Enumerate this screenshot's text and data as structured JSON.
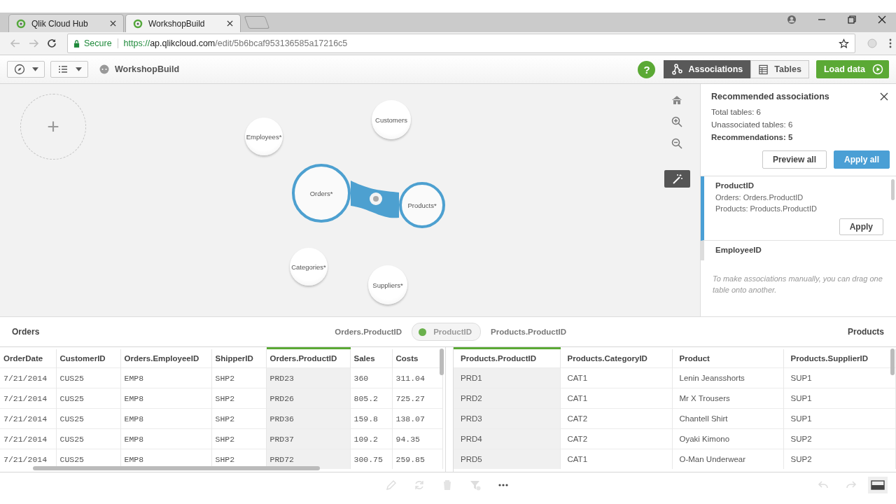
{
  "browser": {
    "tabs": [
      {
        "title": "Qlik Cloud Hub",
        "selected": false
      },
      {
        "title": "WorkshopBuild",
        "selected": true
      }
    ],
    "url": {
      "secure_label": "Secure",
      "scheme": "https://",
      "host": "ap.qlikcloud.com",
      "path": "/edit/5b6bcaf953136585a17216c5"
    }
  },
  "toolbar": {
    "app_name": "WorkshopBuild",
    "help": "?",
    "views": [
      {
        "label": "Associations",
        "selected": true
      },
      {
        "label": "Tables",
        "selected": false
      }
    ],
    "load_button": "Load data"
  },
  "canvas": {
    "add_label": "+",
    "nodes": [
      {
        "label": "Employees*",
        "selected": false
      },
      {
        "label": "Customers",
        "selected": false
      },
      {
        "label": "Orders*",
        "selected": true
      },
      {
        "label": "Products*",
        "selected": true
      },
      {
        "label": "Categories*",
        "selected": false
      },
      {
        "label": "Suppliers*",
        "selected": false
      }
    ]
  },
  "panel": {
    "title": "Recommended associations",
    "stats": [
      {
        "text": "Total tables: 6",
        "kind": "plain"
      },
      {
        "text": "Unassociated tables: 6",
        "kind": "plain"
      },
      {
        "text": "Recommendations: 5",
        "kind": "bold"
      }
    ],
    "preview_button": "Preview all",
    "apply_all_button": "Apply all",
    "recommendations": [
      {
        "title": "ProductID",
        "lines": [
          "Orders: Orders.ProductID",
          "Products: Products.ProductID"
        ],
        "apply": "Apply",
        "selected": true
      },
      {
        "title": "EmployeeID",
        "selected": false
      }
    ],
    "hint": "To make associations manually, you can drag one table onto another."
  },
  "association_bar": {
    "left_table": "Orders",
    "left_field": "Orders.ProductID",
    "key": "ProductID",
    "right_field": "Products.ProductID",
    "right_table": "Products"
  },
  "tables": [
    {
      "columns": [
        {
          "name": "OrderDate",
          "highlighted": false
        },
        {
          "name": "CustomerID",
          "highlighted": false
        },
        {
          "name": "Orders.EmployeeID",
          "highlighted": false
        },
        {
          "name": "ShipperID",
          "highlighted": false
        },
        {
          "name": "Orders.ProductID",
          "highlighted": true
        },
        {
          "name": "Sales",
          "highlighted": false
        },
        {
          "name": "Costs",
          "highlighted": false
        }
      ],
      "rows": [
        [
          "7/21/2014",
          "CUS25",
          "EMP8",
          "SHP2",
          "PRD23",
          "360",
          "311.04"
        ],
        [
          "7/21/2014",
          "CUS25",
          "EMP8",
          "SHP2",
          "PRD26",
          "805.2",
          "725.27"
        ],
        [
          "7/21/2014",
          "CUS25",
          "EMP8",
          "SHP2",
          "PRD36",
          "159.8",
          "138.07"
        ],
        [
          "7/21/2014",
          "CUS25",
          "EMP8",
          "SHP2",
          "PRD37",
          "109.2",
          "94.35"
        ],
        [
          "7/21/2014",
          "CUS25",
          "EMP8",
          "SHP2",
          "PRD72",
          "300.75",
          "259.85"
        ]
      ]
    },
    {
      "columns": [
        {
          "name": "Products.ProductID",
          "highlighted": true
        },
        {
          "name": "Products.CategoryID",
          "highlighted": false
        },
        {
          "name": "Product",
          "highlighted": false
        },
        {
          "name": "Products.SupplierID",
          "highlighted": false
        }
      ],
      "rows": [
        [
          "PRD1",
          "CAT1",
          "Lenin Jeansshorts",
          "SUP1"
        ],
        [
          "PRD2",
          "CAT1",
          "Mr X Trousers",
          "SUP1"
        ],
        [
          "PRD3",
          "CAT2",
          "Chantell Shirt",
          "SUP1"
        ],
        [
          "PRD4",
          "CAT2",
          "Oyaki Kimono",
          "SUP2"
        ],
        [
          "PRD5",
          "CAT1",
          "O-Man Underwear",
          "SUP2"
        ]
      ]
    }
  ]
}
